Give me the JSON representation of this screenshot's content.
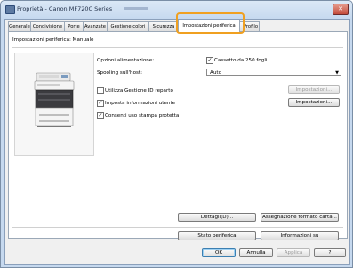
{
  "window": {
    "title": "Proprietà - Canon MF720C Series"
  },
  "tabs": [
    {
      "label": "Generale"
    },
    {
      "label": "Condivisione"
    },
    {
      "label": "Porte"
    },
    {
      "label": "Avanzate"
    },
    {
      "label": "Gestione colori"
    },
    {
      "label": "Sicurezza"
    },
    {
      "label": "Impostazioni periferica"
    },
    {
      "label": "Profilo"
    }
  ],
  "panel": {
    "section_label": "Impostazioni periferica: Manuale",
    "power_options_label": "Opzioni alimentazione:",
    "drawer_checkbox": {
      "label": "Cassetto da 250 fogli",
      "checked": true
    },
    "spooling_label": "Spooling sull'host:",
    "spooling_value": "Auto",
    "department_id": {
      "label": "Utilizza Gestione ID reparto",
      "checked": false
    },
    "user_info": {
      "label": "Imposta informazioni utente",
      "checked": true
    },
    "secure_print": {
      "label": "Consenti uso stampa protetta",
      "checked": true
    },
    "settings_button_disabled": "Impostazioni...",
    "settings_button": "Impostazioni...",
    "details_button": "Dettagli(D)...",
    "paper_format_button": "Assegnazione formato carta...",
    "device_status_button": "Stato periferica",
    "info_button": "Informazioni su"
  },
  "footer": {
    "ok": "OK",
    "cancel": "Annulla",
    "apply": "Applica",
    "help": "?"
  },
  "colors": {
    "highlight": "#f0a020",
    "titlebar": "#c6d9ef",
    "close": "#c34b3b"
  }
}
